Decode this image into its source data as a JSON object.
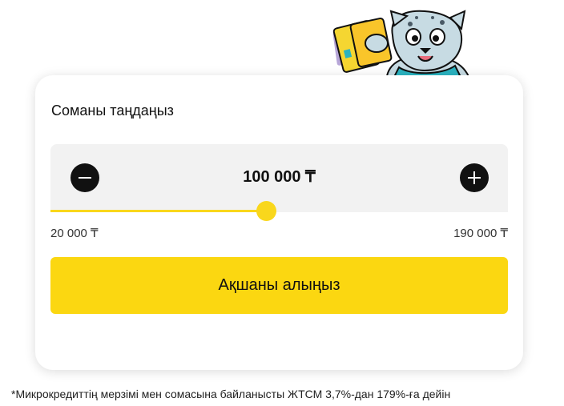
{
  "card": {
    "title": "Соманы таңдаңыз"
  },
  "amount": {
    "value": "100 000 ₸",
    "min_label": "20 000 ₸",
    "max_label": "190 000 ₸",
    "min": 20000,
    "max": 190000,
    "current": 100000
  },
  "controls": {
    "decrease_icon": "minus-icon",
    "increase_icon": "plus-icon"
  },
  "cta": {
    "label": "Ақшаны алыңыз"
  },
  "footnote": "*Микрокредиттің мерзімі мен сомасына байланысты ЖТСМ 3,7%-дан 179%-ға дейін",
  "colors": {
    "accent": "#F9D71C",
    "button": "#FBD711",
    "panel": "#F2F2F2",
    "dark": "#111111"
  }
}
